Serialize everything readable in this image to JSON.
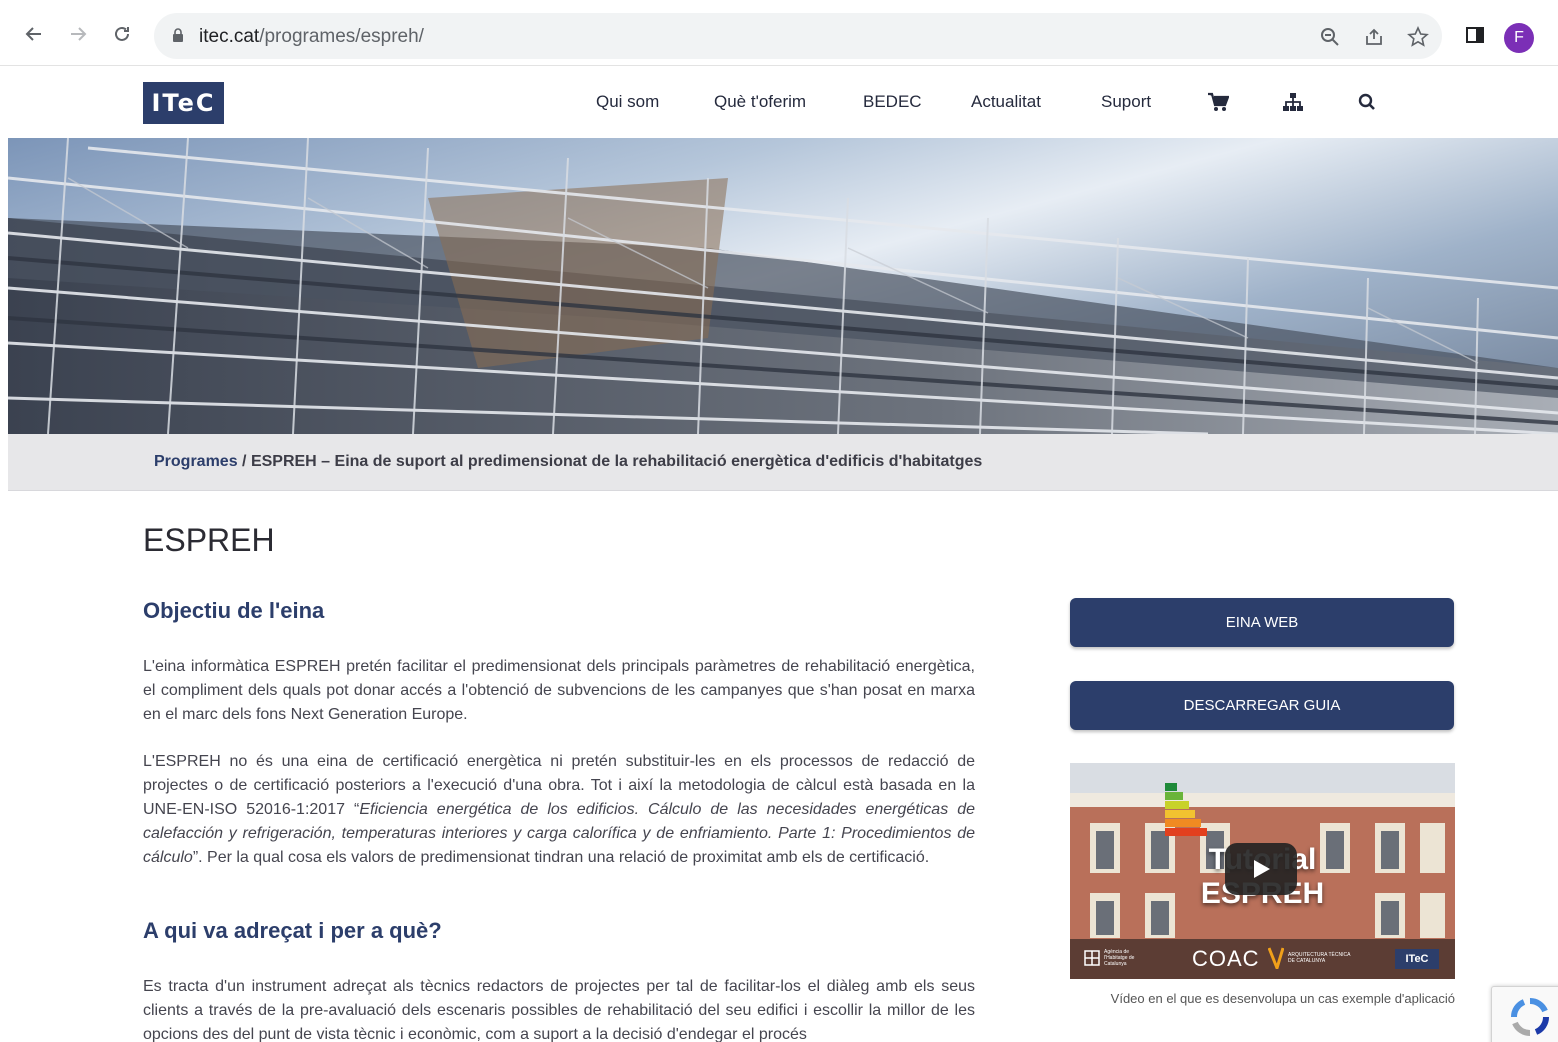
{
  "browser": {
    "url_host": "itec.cat",
    "url_path": "/programes/espreh/",
    "profile_initial": "F"
  },
  "header": {
    "logo_text": "ITeC",
    "nav": [
      "Qui som",
      "Què t'oferim",
      "BEDEC",
      "Actualitat",
      "Suport"
    ]
  },
  "breadcrumb": {
    "root": "Programes",
    "separator": " / ",
    "current": "ESPREH – Eina de suport al predimensionat de la rehabilitació energètica d'edificis d'habitatges"
  },
  "content": {
    "title": "ESPREH",
    "section1_heading": "Objectiu de l'eina",
    "para1": "L'eina informàtica ESPREH pretén facilitar el predimensionat dels principals paràmetres de rehabilitació energètica, el compliment dels quals pot donar accés a l'obtenció de subvencions de les campanyes que s'han posat en marxa en el marc dels fons Next Generation Europe.",
    "para2_a": "L'ESPREH no és una eina de certificació energètica ni pretén substituir-les en els processos de redacció de projectes o de certificació posteriors a l'execució d'una obra. Tot i així la metodologia de càlcul està basada en la UNE-EN-ISO 52016-1:2017 “",
    "para2_italic": "Eficiencia energética de los edificios. Cálculo de las necesidades energéticas de calefacción y refrigeración, temperaturas interiores y carga calorífica y de enfriamiento. Parte 1: Procedimientos de cálculo",
    "para2_b": "”. Per la qual cosa els valors de predimensionat tindran una relació de proximitat amb els de certificació.",
    "section2_heading": "A qui va adreçat i per a què?",
    "para3": "Es tracta d'un instrument adreçat als tècnics redactors de projectes per tal de facilitar-los el diàleg amb els seus clients a través de la pre-avaluació dels escenaris possibles de rehabilitació del seu edifici i escollir la millor de les opcions des del punt de vista tècnic i econòmic, com a suport a la decisió d'endegar el procés"
  },
  "sidebar": {
    "button1": "EINA WEB",
    "button2": "DESCARREGAR GUIA",
    "video_title_line1": "Tutorial",
    "video_title_line2": "ESPREH",
    "video_logo1": "Agència de l'Habitatge de Catalunya",
    "video_logo2": "COAC",
    "video_logo3": "ARQUITECTURA TÈCNICA DE CATALUNYA",
    "video_logo4": "ITeC",
    "caption": "Vídeo en el que es desenvolupa un cas exemple d'aplicació"
  },
  "colors": {
    "brand": "#2c3e6b",
    "breadcrumb_bg": "#e7e7e9",
    "text": "#45454f"
  }
}
